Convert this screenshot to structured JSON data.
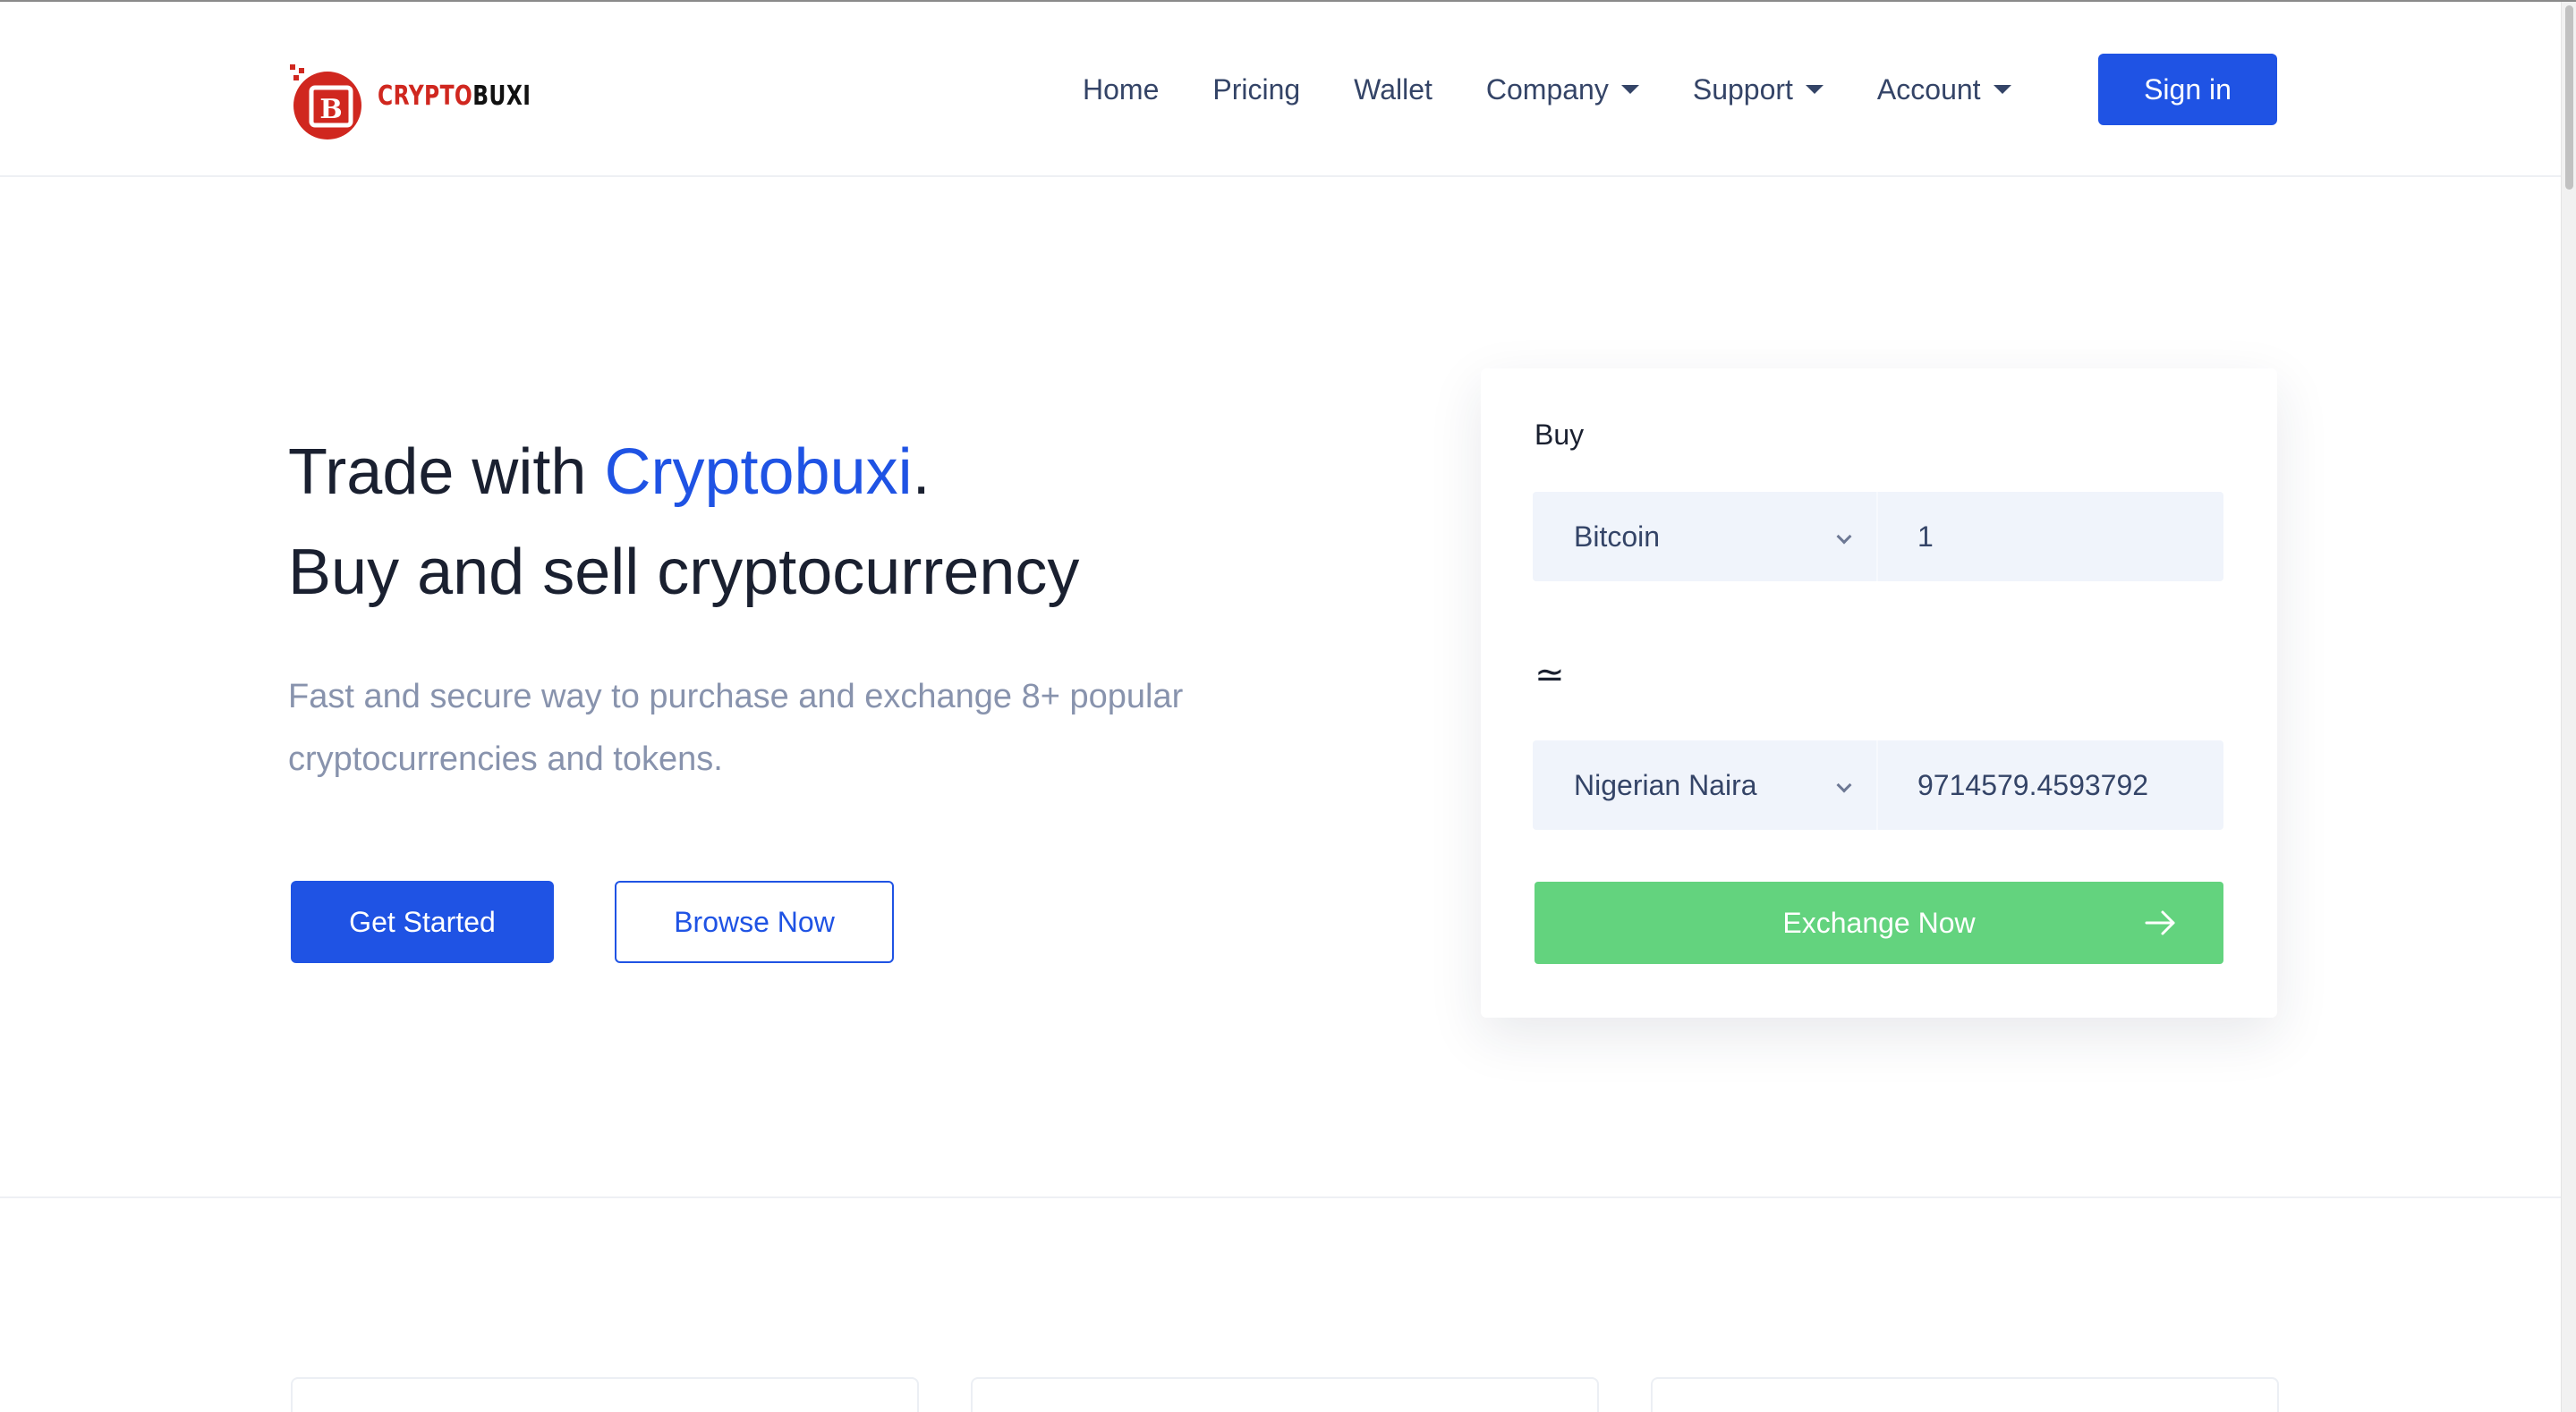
{
  "brand": {
    "logo_letter": "B",
    "logo_part1": "CRYPTO",
    "logo_part2": "BUXI"
  },
  "nav": {
    "items": [
      {
        "label": "Home",
        "dropdown": false
      },
      {
        "label": "Pricing",
        "dropdown": false
      },
      {
        "label": "Wallet",
        "dropdown": false
      },
      {
        "label": "Company",
        "dropdown": true
      },
      {
        "label": "Support",
        "dropdown": true
      },
      {
        "label": "Account",
        "dropdown": true
      }
    ],
    "signin_label": "Sign in"
  },
  "hero": {
    "title_prefix": "Trade with ",
    "title_brand": "Cryptobuxi",
    "title_suffix": ".",
    "title_line2": "Buy and sell cryptocurrency",
    "description": "Fast and secure way to purchase and exchange 8+ popular cryptocurrencies and tokens.",
    "primary_button": "Get Started",
    "secondary_button": "Browse Now"
  },
  "exchange": {
    "label": "Buy",
    "from_currency": "Bitcoin",
    "from_amount": "1",
    "approx_symbol": "≃",
    "to_currency": "Nigerian Naira",
    "to_amount": "9714579.4593792",
    "button_label": "Exchange Now"
  },
  "colors": {
    "primary": "#1f53e4",
    "success": "#63d37e",
    "logo_red": "#d0271f",
    "text_muted": "#8893ad"
  }
}
